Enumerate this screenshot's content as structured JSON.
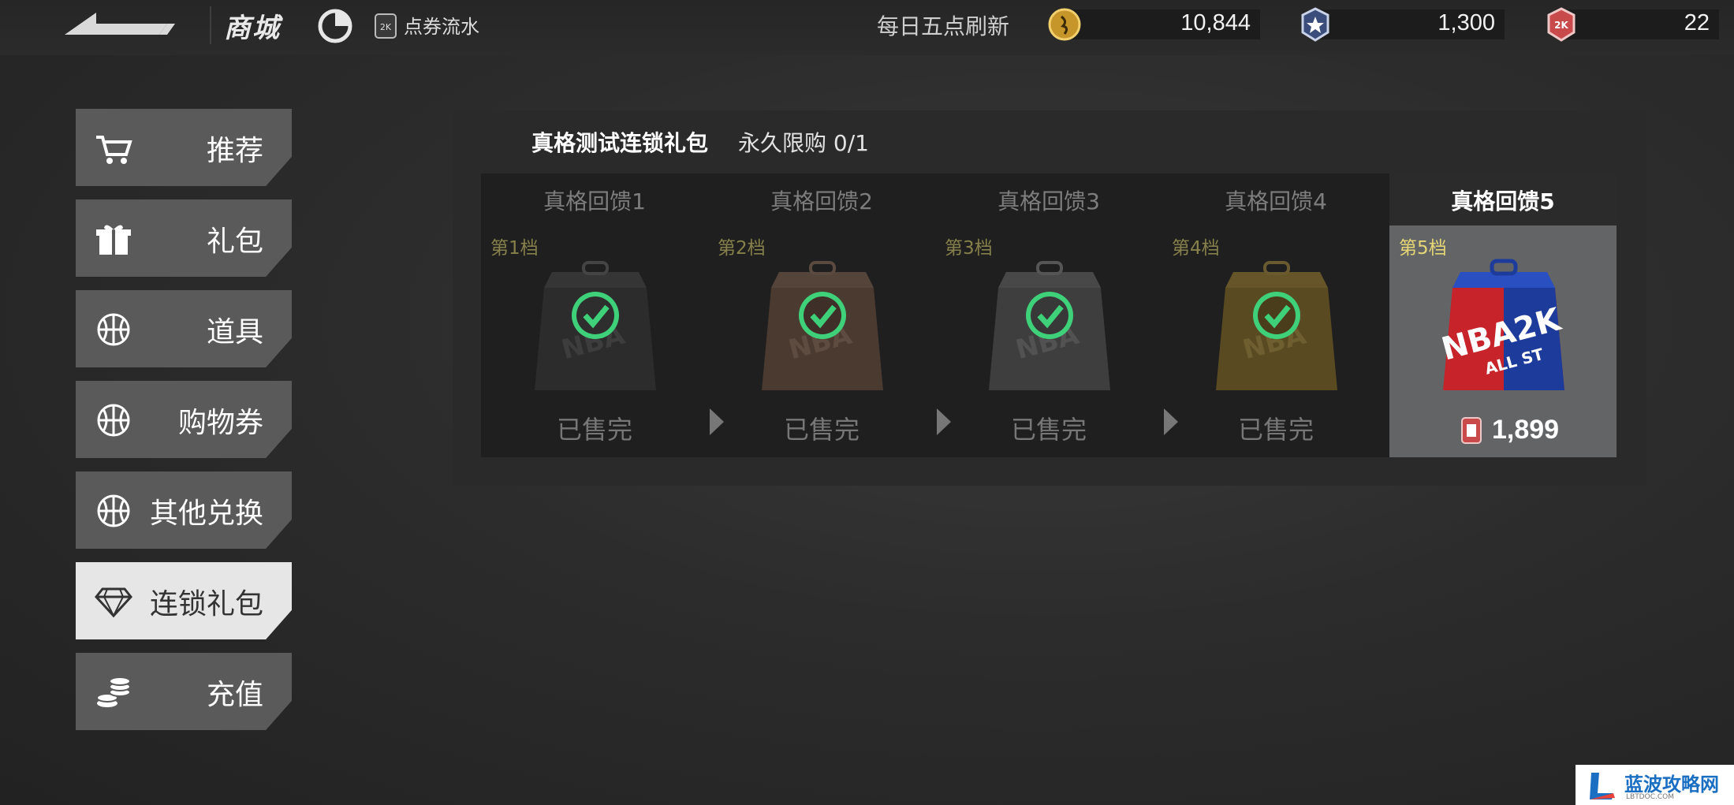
{
  "header": {
    "title": "商城",
    "flow_link": "点券流水",
    "refresh_text": "每日五点刷新",
    "currencies": [
      {
        "name": "gold-coin",
        "value": "10,844"
      },
      {
        "name": "star-badge",
        "value": "1,300"
      },
      {
        "name": "vc-ticket",
        "value": "22"
      }
    ]
  },
  "sidebar": {
    "items": [
      {
        "label": "推荐",
        "icon": "cart-icon"
      },
      {
        "label": "礼包",
        "icon": "gift-icon"
      },
      {
        "label": "道具",
        "icon": "basketball-icon"
      },
      {
        "label": "购物券",
        "icon": "basketball-icon"
      },
      {
        "label": "其他兑换",
        "icon": "basketball-icon"
      },
      {
        "label": "连锁礼包",
        "icon": "diamond-icon"
      },
      {
        "label": "充值",
        "icon": "coins-icon"
      }
    ],
    "active_index": 5
  },
  "pack": {
    "title": "真格测试连锁礼包",
    "limit": "永久限购 0/1",
    "tiers": [
      {
        "name": "真格回馈1",
        "level": "第1档",
        "status": "已售完"
      },
      {
        "name": "真格回馈2",
        "level": "第2档",
        "status": "已售完"
      },
      {
        "name": "真格回馈3",
        "level": "第3档",
        "status": "已售完"
      },
      {
        "name": "真格回馈4",
        "level": "第4档",
        "status": "已售完"
      },
      {
        "name": "真格回馈5",
        "level": "第5档",
        "price": "1,899"
      }
    ]
  },
  "watermark": {
    "text": "蓝波攻略网",
    "sub": "LBTDOC.COM"
  },
  "colors": {
    "active_tab": "#e6e6e6",
    "tab": "#5a5a5a",
    "check": "#3fd17a",
    "level_gold": "#e6d776"
  }
}
